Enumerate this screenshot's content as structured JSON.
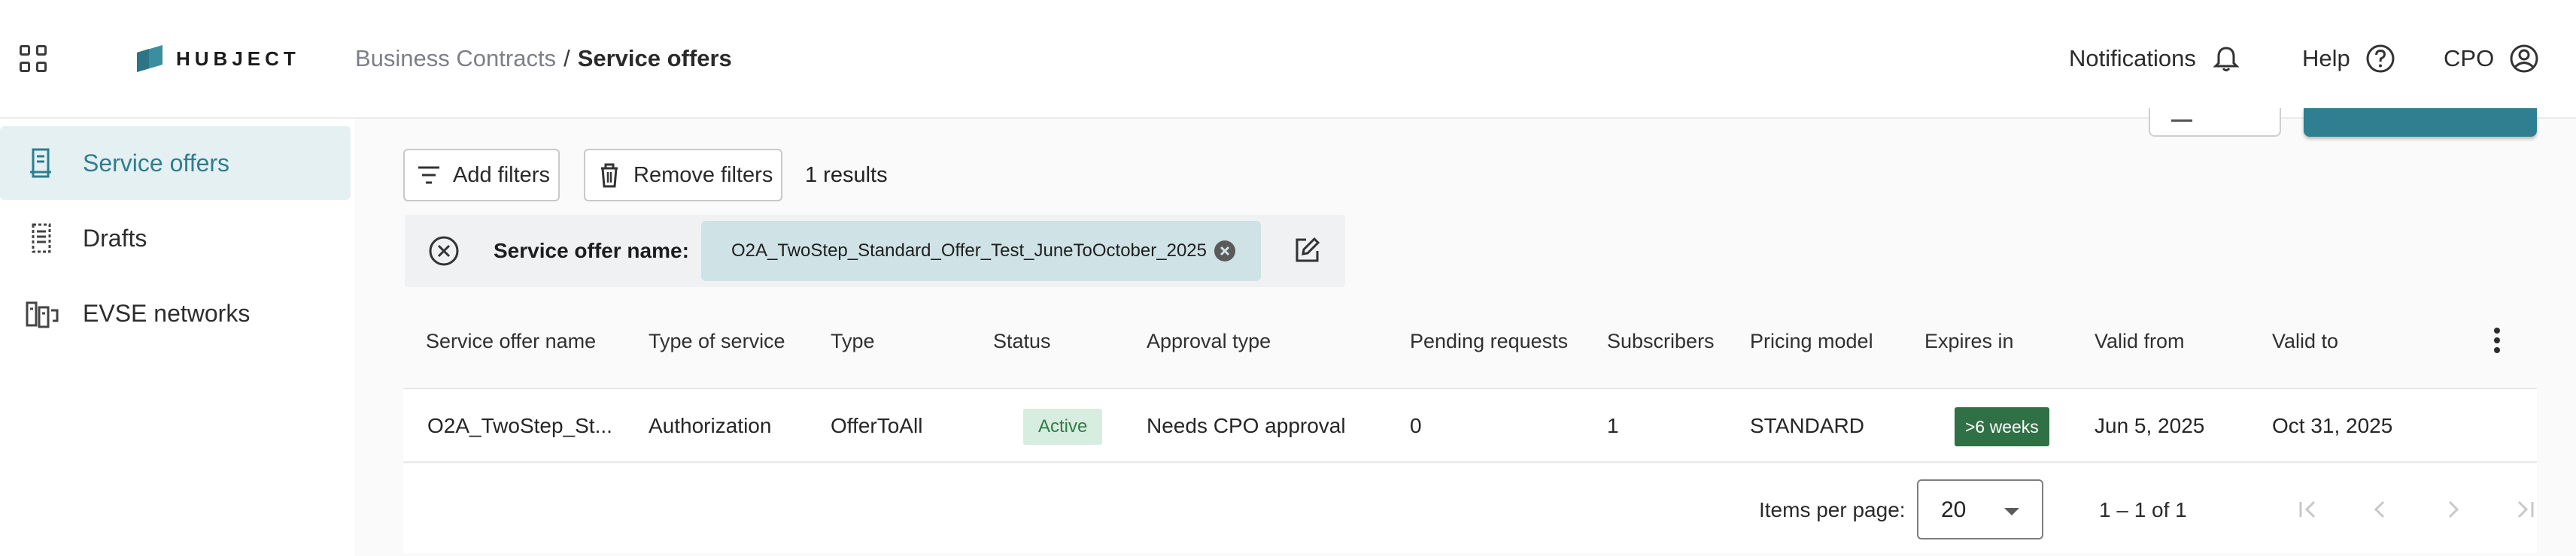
{
  "app": {
    "logo_text": "HUBJECT"
  },
  "breadcrumb": {
    "parent": "Business Contracts",
    "separator": "/",
    "current": "Service offers"
  },
  "header": {
    "notifications": "Notifications",
    "help": "Help",
    "user": "CPO"
  },
  "sidebar": {
    "items": [
      {
        "label": "Service offers",
        "icon": "document-icon",
        "active": true
      },
      {
        "label": "Drafts",
        "icon": "drafts-icon",
        "active": false
      },
      {
        "label": "EVSE networks",
        "icon": "evse-network-icon",
        "active": false
      }
    ]
  },
  "toolbar": {
    "add_filters": "Add filters",
    "remove_filters": "Remove filters",
    "results": "1 results"
  },
  "filter_chip": {
    "label": "Service offer name:",
    "value": "O2A_TwoStep_Standard_Offer_Test_JuneToOctober_2025"
  },
  "table": {
    "columns": [
      "Service offer name",
      "Type of service",
      "Type",
      "Status",
      "Approval type",
      "Pending requests",
      "Subscribers",
      "Pricing model",
      "Expires in",
      "Valid from",
      "Valid to"
    ],
    "rows": [
      {
        "service_offer_name": "O2A_TwoStep_St...",
        "type_of_service": "Authorization",
        "type": "OfferToAll",
        "status": "Active",
        "approval_type": "Needs CPO approval",
        "pending_requests": "0",
        "subscribers": "1",
        "pricing_model": "STANDARD",
        "expires_in": ">6 weeks",
        "valid_from": "Jun 5, 2025",
        "valid_to": "Oct 31, 2025"
      }
    ]
  },
  "pagination": {
    "items_per_page_label": "Items per page:",
    "page_size": "20",
    "range": "1 – 1 of 1"
  },
  "colors": {
    "accent": "#2e7e8f",
    "active_bg": "#e4f0f2",
    "status_bg": "#d7eddf",
    "expires_bg": "#2f7044"
  }
}
